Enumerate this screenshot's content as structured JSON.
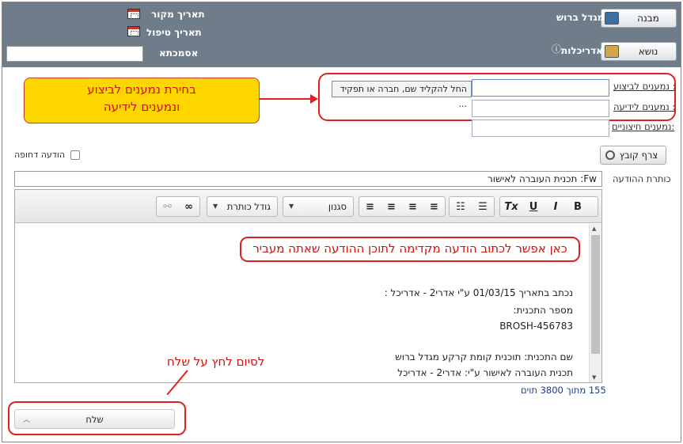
{
  "header": {
    "structure_button": "מבנה",
    "structure_value": "מגדל ברוש",
    "subject_button": "נושא",
    "subject_value": "אדריכלות",
    "source_date_label": "תאריך מקור",
    "handling_date_label": "תאריך טיפול",
    "reference_label": "אסמכתא",
    "reference_value": ""
  },
  "recipients": {
    "to_label": "נמענים לביצוע :",
    "cc_label": "נמענים לידיעה :",
    "external_label": "נמענים חיצוניים:",
    "picker_placeholder": "החל להקליד שם, חברה או תפקיד ..."
  },
  "annotations": {
    "callout_line1": "בחירת נמענים לביצוע",
    "callout_line2": "ונמענים לידיעה",
    "preface_note": "כאן אפשר לכתוב הודעה מקדימה לתוכן ההודעה שאתה מעביר",
    "send_note": "לסיום לחץ על שלח"
  },
  "actions": {
    "attach_label": "צרף קובץ",
    "urgent_label": "הודעה דחופה",
    "send_label": "שלח"
  },
  "message": {
    "subject_label": "כותרת ההודעה",
    "subject_value": "Fw: תכנית העוברה לאישור",
    "body_lines": [
      "נכתב בתאריך 01/03/15 ע\"י אדרי2 - אדריכל :",
      "מספר התכנית:",
      "BROSH-456783",
      "",
      "שם התכנית: תוכנית קומת קרקע מגדל ברוש",
      "תכנית העוברה לאישור ע\"י: אדרי2 - אדריכל"
    ],
    "char_counter": "155 מתוך 3800 תוים"
  },
  "toolbar": {
    "bold": "B",
    "italic": "I",
    "underline": "U",
    "clear_format": "Tx",
    "style_combo": "סגנון",
    "font_size_combo": "גודל כותרת"
  }
}
